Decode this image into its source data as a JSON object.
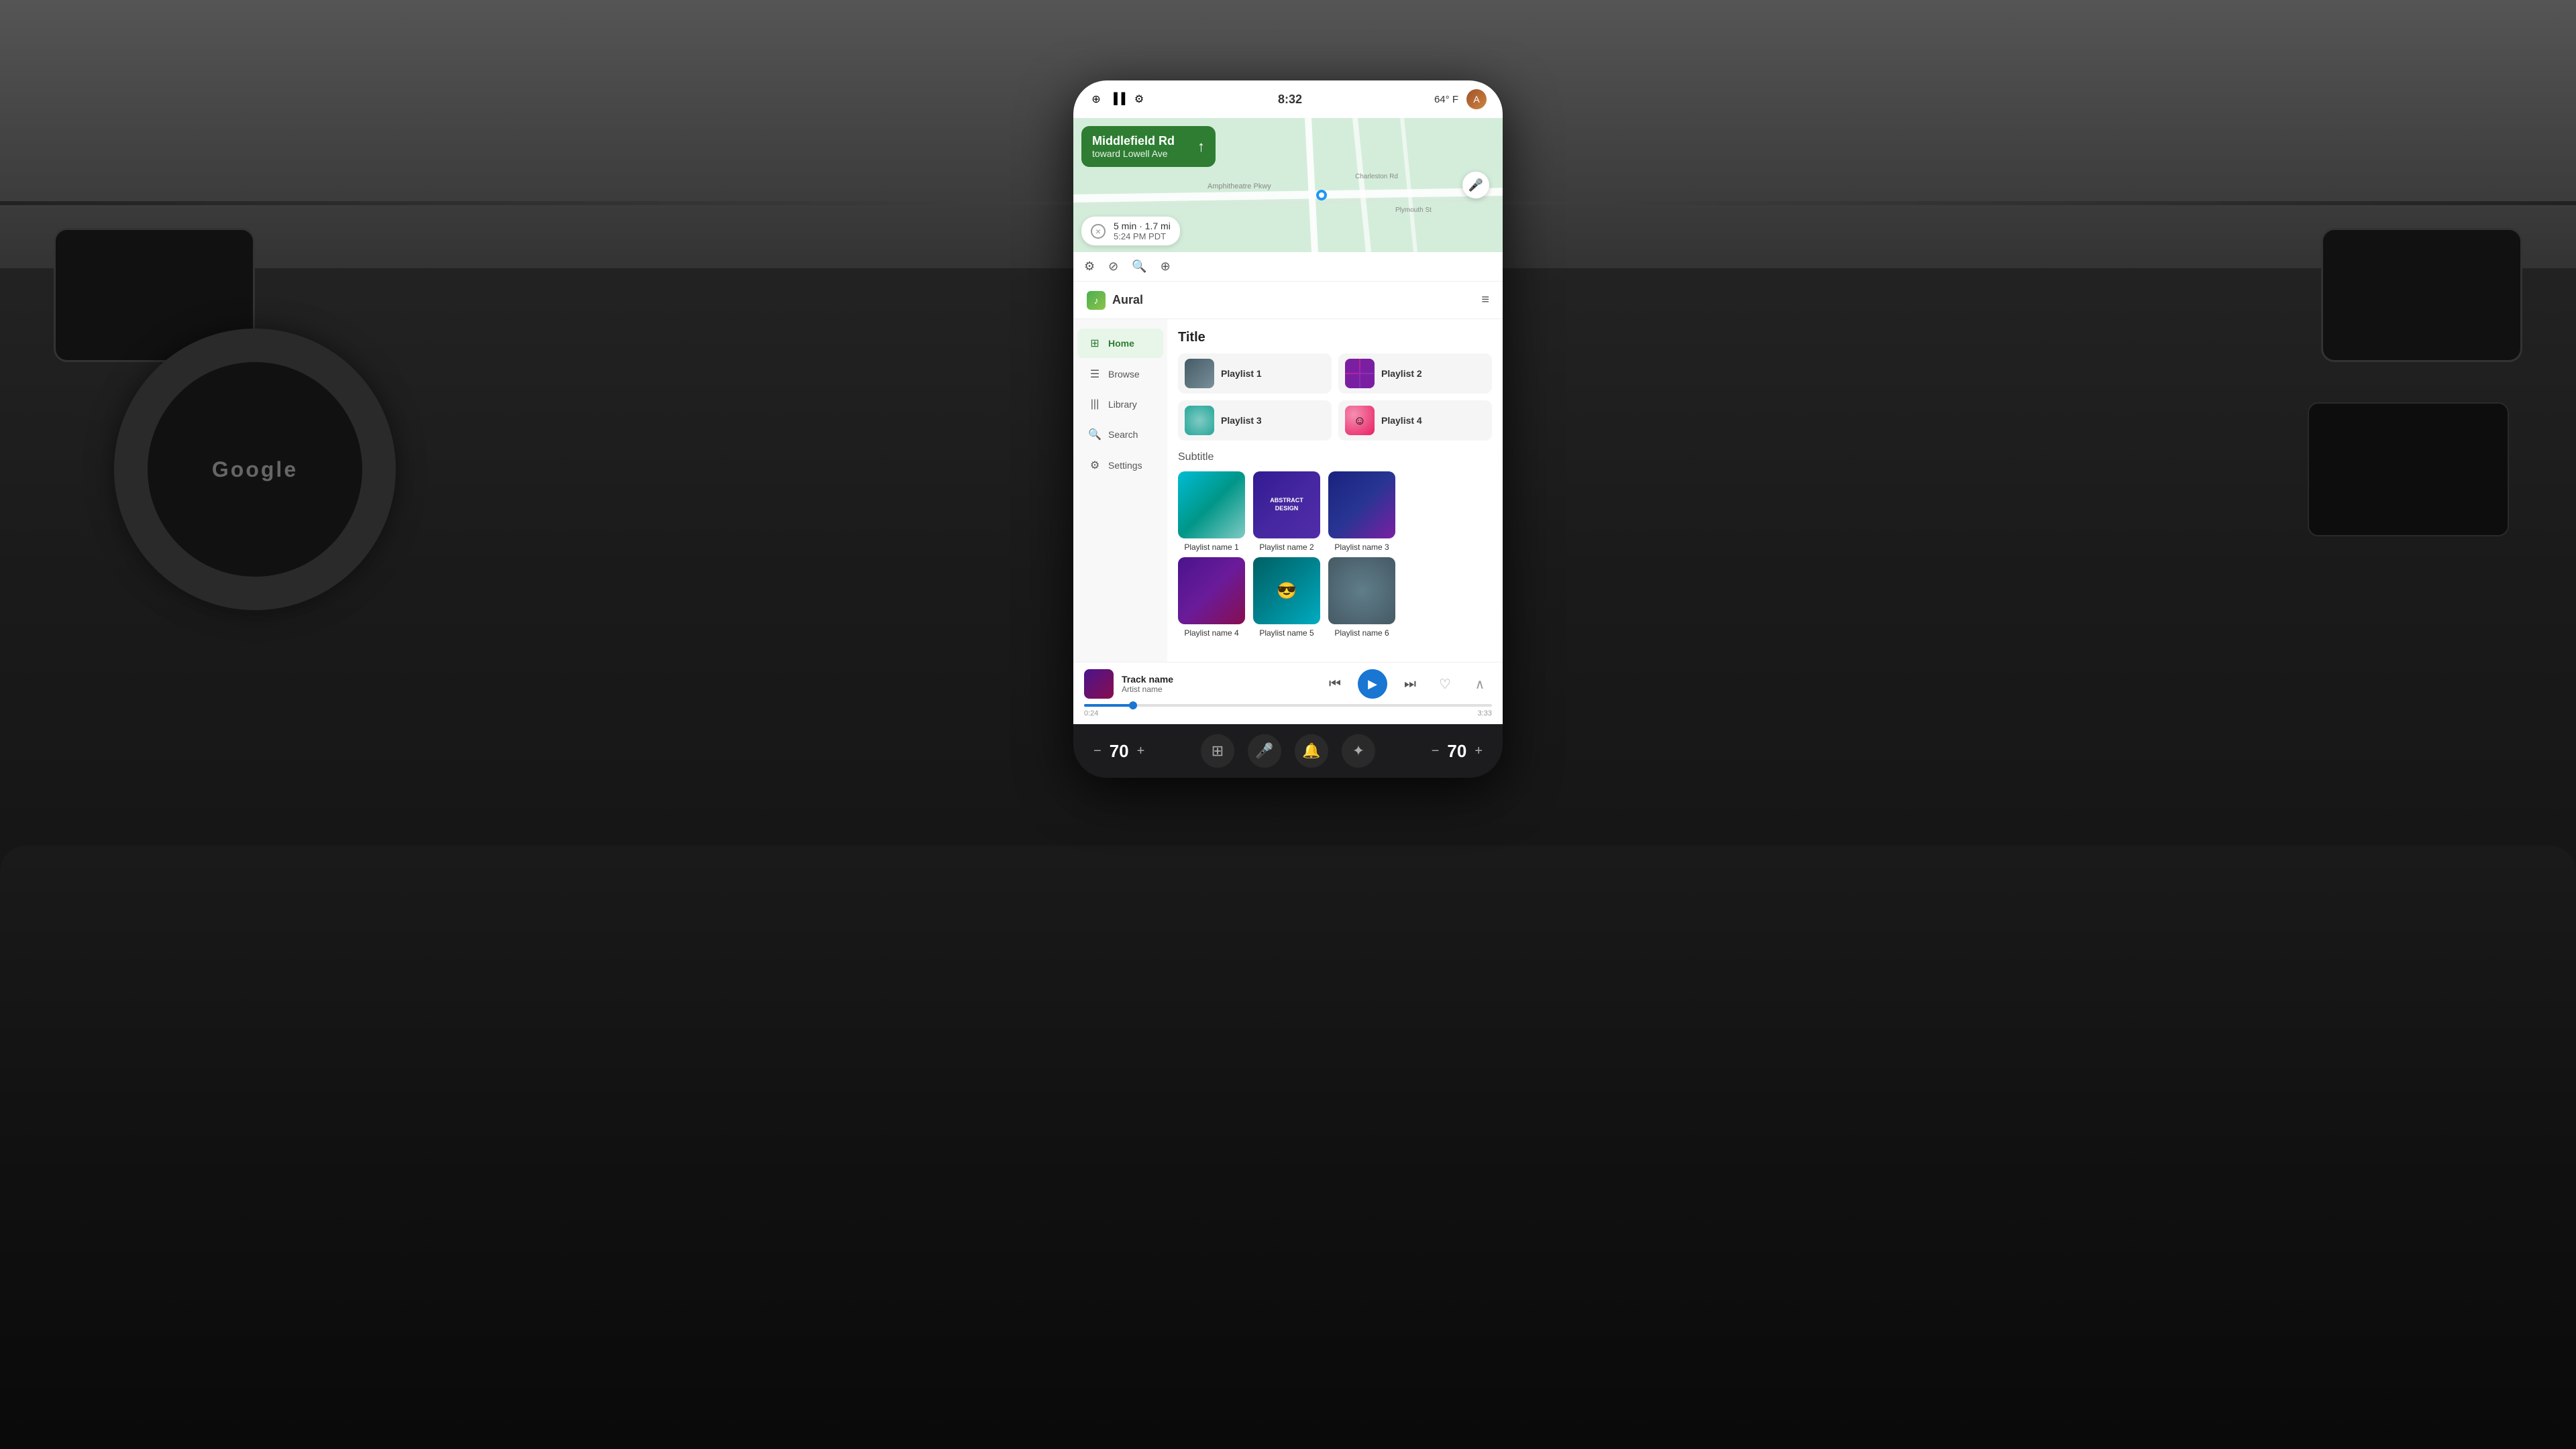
{
  "car": {
    "background_desc": "Car interior with steering wheel and dashboard"
  },
  "status_bar": {
    "bluetooth_icon": "⊕",
    "signal_icon": "▐▐",
    "settings_icon": "⚙",
    "time": "8:32",
    "temp": "64° F",
    "avatar_initial": "A"
  },
  "navigation": {
    "street": "Middlefield Rd",
    "toward": "toward Lowell Ave",
    "arrow": "↑",
    "close_icon": "×",
    "eta_distance": "5 min · 1.7 mi",
    "eta_time": "5:24 PM PDT"
  },
  "map_toolbar": {
    "btn1": "⚙",
    "btn2": "⊘",
    "btn3": "🔍",
    "btn4": "⊕"
  },
  "app": {
    "name": "Aural",
    "queue_icon": "☰"
  },
  "sidebar": {
    "items": [
      {
        "label": "Home",
        "icon": "⊞",
        "active": true
      },
      {
        "label": "Browse",
        "icon": "☰",
        "active": false
      },
      {
        "label": "Library",
        "icon": "|||",
        "active": false
      },
      {
        "label": "Search",
        "icon": "🔍",
        "active": false
      },
      {
        "label": "Settings",
        "icon": "⚙",
        "active": false
      }
    ]
  },
  "main": {
    "title": "Title",
    "subtitle": "Subtitle",
    "playlists_grid": [
      {
        "name": "Playlist 1",
        "thumb_class": "playlist-thumb-1"
      },
      {
        "name": "Playlist 2",
        "thumb_class": "playlist-thumb-2"
      },
      {
        "name": "Playlist 3",
        "thumb_class": "playlist-thumb-3"
      },
      {
        "name": "Playlist 4",
        "thumb_class": "playlist-thumb-4"
      }
    ],
    "playlists_row1": [
      {
        "name": "Playlist name 1",
        "thumb_class": "thumb-girl"
      },
      {
        "name": "Playlist name 2",
        "thumb_class": "thumb-abstract"
      },
      {
        "name": "Playlist name 3",
        "thumb_class": "thumb-concert"
      }
    ],
    "playlists_row2": [
      {
        "name": "Playlist name 4",
        "thumb_class": "thumb-purple"
      },
      {
        "name": "Playlist name 5",
        "thumb_class": "thumb-teal"
      },
      {
        "name": "Playlist name 6",
        "thumb_class": "thumb-gray"
      }
    ]
  },
  "player": {
    "track_name": "Track name",
    "artist_name": "Artist name",
    "current_time": "0:24",
    "total_time": "3:33",
    "progress_pct": 12,
    "prev_icon": "⏮",
    "play_icon": "▶",
    "next_icon": "⏭",
    "heart_icon": "♡",
    "expand_icon": "∧"
  },
  "bottom_controls": {
    "vol_minus_left": "−",
    "vol_num_left": "70",
    "vol_plus_left": "+",
    "grid_icon": "⊞",
    "mic_icon": "🎤",
    "bell_icon": "🔔",
    "star_icon": "✦",
    "vol_minus_right": "−",
    "vol_num_right": "70",
    "vol_plus_right": "+"
  }
}
